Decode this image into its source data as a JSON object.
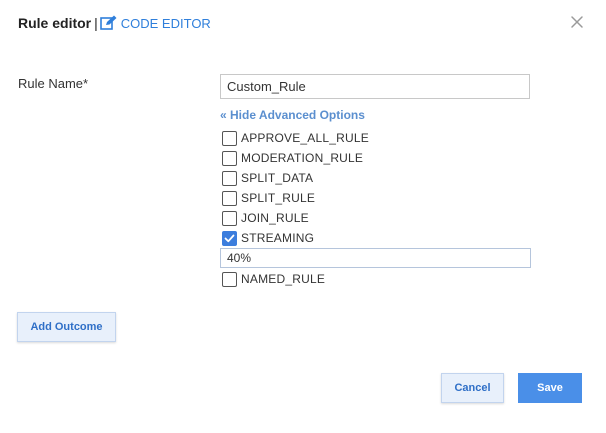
{
  "header": {
    "title": "Rule editor",
    "separator": "|",
    "code_editor_label": "CODE EDITOR"
  },
  "form": {
    "rule_name_label": "Rule Name*",
    "rule_name_value": "Custom_Rule",
    "advanced_toggle_label": "« Hide Advanced Options"
  },
  "options": [
    {
      "label": "APPROVE_ALL_RULE",
      "checked": false
    },
    {
      "label": "MODERATION_RULE",
      "checked": false
    },
    {
      "label": "SPLIT_DATA",
      "checked": false
    },
    {
      "label": "SPLIT_RULE",
      "checked": false
    },
    {
      "label": "JOIN_RULE",
      "checked": false
    },
    {
      "label": "STREAMING",
      "checked": true
    },
    {
      "label": "NAMED_RULE",
      "checked": false
    }
  ],
  "streaming_percent_value": "40%",
  "buttons": {
    "add_outcome": "Add Outcome",
    "cancel": "Cancel",
    "save": "Save"
  },
  "colors": {
    "accent": "#2f7fdb",
    "link": "#5b8fcf",
    "checkbox_checked": "#3b7ddd",
    "save_button": "#4a8fe8",
    "outline_button_bg": "#e8f0fb"
  }
}
